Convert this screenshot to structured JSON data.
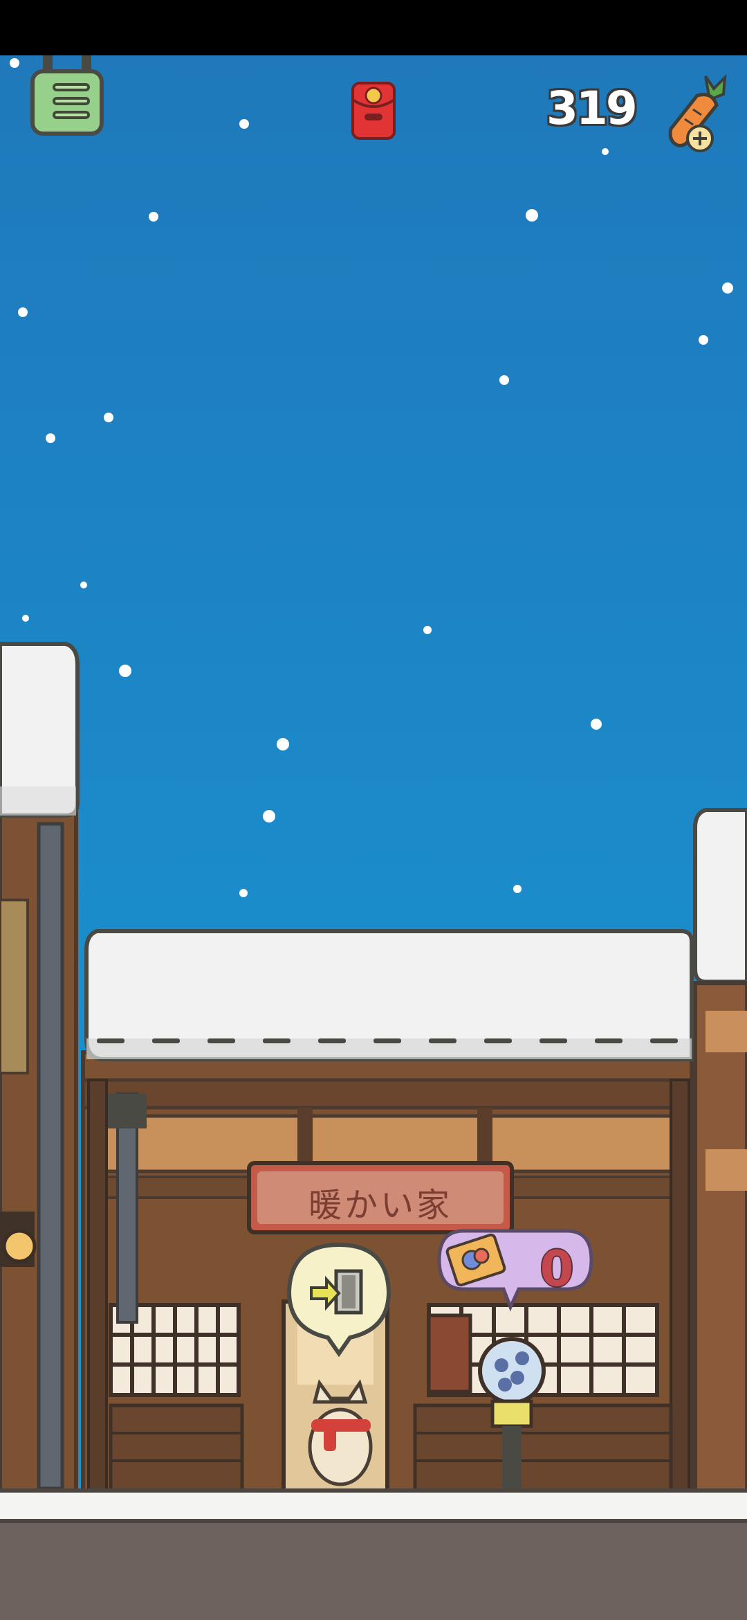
{
  "hud": {
    "carrot_count": "319",
    "icons": {
      "menu": "menu-list-icon",
      "red_envelope": "red-envelope-icon",
      "carrot": "carrot-add-icon"
    }
  },
  "shop": {
    "sign_text": "暖かい家",
    "ticket_count": "0"
  },
  "colors": {
    "sky_top": "#1f79bb",
    "sky_bottom": "#1a92cf",
    "roof_snow": "#f2f2f2",
    "wood": "#8a5a3a",
    "ground": "#6d625d",
    "token_bubble": "#d7b8ea",
    "door_bubble": "#f6f1c8"
  }
}
